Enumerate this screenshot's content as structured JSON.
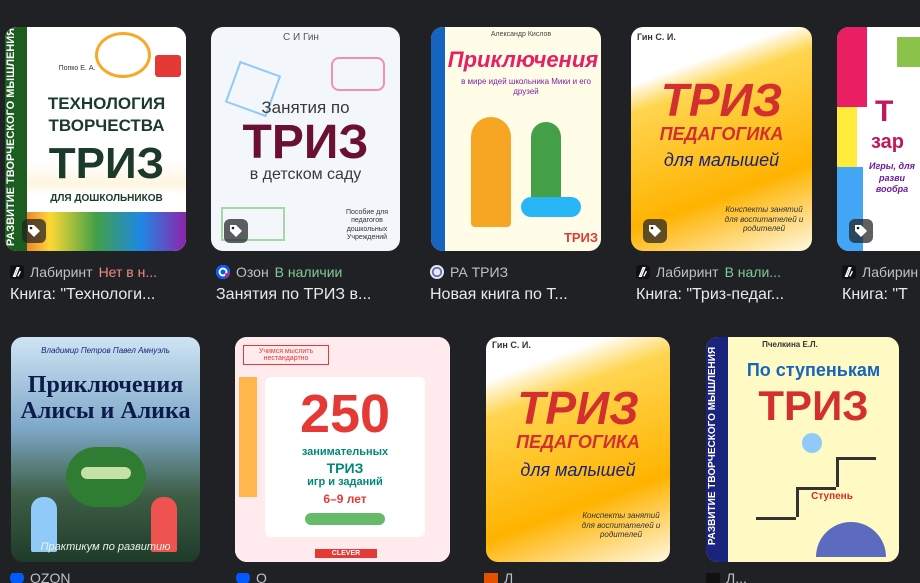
{
  "results": [
    {
      "source": "Лабиринт",
      "availability": "Нет в н...",
      "title": "Книга: \"Технологи...",
      "cover": {
        "author": "Попко Е. А.",
        "line1": "ТЕХНОЛОГИЯ",
        "line2": "ТВОРЧЕСТВА",
        "line3": "ТРИЗ",
        "line4": "ДЛЯ ДОШКОЛЬНИКОВ",
        "spine": "РАЗВИТИЕ ТВОРЧЕСКОГО МЫШЛЕНИЯ"
      }
    },
    {
      "source": "Озон",
      "availability": "В наличии",
      "title": "Занятия по ТРИЗ в...",
      "cover": {
        "author": "С И Гин",
        "line1": "Занятия по",
        "line2": "ТРИЗ",
        "line3": "в детском саду",
        "note": "Пособие для педагогов дошкольных Учреждений"
      }
    },
    {
      "source": "РА ТРИЗ",
      "availability": "",
      "title": "Новая книга по Т...",
      "cover": {
        "author": "Александр Кислов",
        "line1": "Приключения",
        "line2": "в мире идей школьника Мики и его друзей",
        "line3": "ТРИЗ"
      }
    },
    {
      "source": "Лабиринт",
      "availability": "В нали...",
      "title": "Книга: \"Триз-педаг...",
      "cover": {
        "author": "Гин С. И.",
        "line1": "ТРИЗ",
        "line2": "ПЕДАГОГИКА",
        "line3": "для малышей",
        "note": "Конспекты занятий для воспитателей и родителей"
      }
    },
    {
      "source": "Лабирин",
      "availability": "",
      "title": "Книга: \"Т",
      "cover": {
        "line1": "Т",
        "line2": "зар",
        "line3": "Игры, для разви вообра"
      }
    }
  ],
  "row2": [
    {
      "source": "OZON",
      "cover": {
        "authors": "Владимир Петров   Павел Амнуэль",
        "line1": "Приключения",
        "line2": "Алисы и Алика",
        "line3": "Практикум по развитию"
      }
    },
    {
      "source": "О",
      "cover": {
        "badge": "Учимся мыслить нестандартно",
        "line1": "250",
        "line2": "занимательных",
        "line3": "ТРИЗ",
        "line4": "игр и заданий",
        "line5": "6–9 лет",
        "publisher": "CLEVER"
      }
    },
    {
      "source": "Л",
      "cover": {
        "author": "Гин С. И.",
        "line1": "ТРИЗ",
        "line2": "ПЕДАГОГИКА",
        "line3": "для малышей",
        "note": "Конспекты занятий для воспитателей и родителей"
      }
    },
    {
      "source": "Л...",
      "cover": {
        "author": "Пчелкина Е.Л.",
        "line1": "По ступенькам",
        "line2": "ТРИЗ",
        "spine": "РАЗВИТИЕ ТВОРЧЕСКОГО МЫШЛЕНИЯ",
        "step": "Ступень"
      }
    }
  ],
  "icons": {
    "tag": "tag-icon",
    "labirint": "labirint-logo-icon",
    "ozon": "ozon-logo-icon",
    "ratriz": "ratriz-logo-icon"
  },
  "colors": {
    "background": "#202124",
    "in_stock": "#81c995",
    "out_of_stock": "#f28b82"
  }
}
